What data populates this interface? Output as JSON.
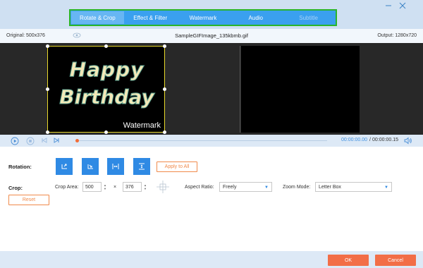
{
  "tabs": [
    {
      "label": "Rotate & Crop",
      "active": true
    },
    {
      "label": "Effect & Filter",
      "active": false
    },
    {
      "label": "Watermark",
      "active": false
    },
    {
      "label": "Audio",
      "active": false
    },
    {
      "label": "Subtitle",
      "active": false
    }
  ],
  "window": {
    "minimize_icon": "minimize-icon",
    "close_icon": "close-icon"
  },
  "info": {
    "original": "Original: 500x376",
    "filename": "SampleGIFImage_135kbmb.gif",
    "output": "Output: 1280x720"
  },
  "preview": {
    "line1": "Happy",
    "line2": "Birthday",
    "watermark": "Watermark"
  },
  "playback": {
    "current_time": "00:00:00.00",
    "separator": "/",
    "total_time": "00:00:00.15",
    "progress_fraction": 0.0
  },
  "rotation": {
    "label": "Rotation:",
    "apply_all": "Apply to All",
    "buttons": [
      "rotate-left-icon",
      "rotate-right-icon",
      "flip-horizontal-icon",
      "flip-vertical-icon"
    ]
  },
  "crop": {
    "label": "Crop:",
    "area_label": "Crop Area:",
    "width": "500",
    "times": "×",
    "height": "376",
    "aspect_label": "Aspect Ratio:",
    "aspect_value": "Freely",
    "zoom_label": "Zoom Mode:",
    "zoom_value": "Letter Box",
    "reset": "Reset"
  },
  "footer": {
    "ok": "OK",
    "cancel": "Cancel"
  },
  "colors": {
    "accent": "#2f8ae4",
    "orange": "#f26e47",
    "tab_border": "#2ab52a"
  }
}
